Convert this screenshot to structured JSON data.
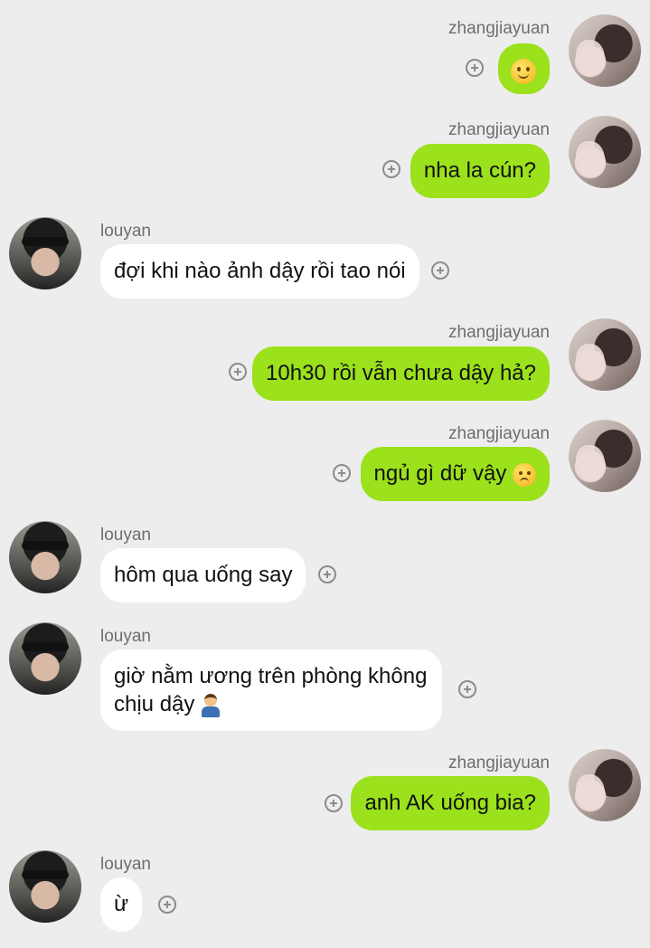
{
  "messages": [
    {
      "sender": "zhangjiayuan",
      "side": "right",
      "text": "",
      "emoji": "slightly-smiling-face"
    },
    {
      "sender": "zhangjiayuan",
      "side": "right",
      "text": "nha la cún?"
    },
    {
      "sender": "louyan",
      "side": "left",
      "text": "đợi khi nào ảnh dậy rồi tao nói"
    },
    {
      "sender": "zhangjiayuan",
      "side": "right",
      "text": "10h30 rồi vẫn chưa dậy hả?"
    },
    {
      "sender": "zhangjiayuan",
      "side": "right",
      "text": "ngủ gì dữ vậy",
      "emoji": "sad-face"
    },
    {
      "sender": "louyan",
      "side": "left",
      "text": "hôm qua uống say"
    },
    {
      "sender": "louyan",
      "side": "left",
      "text": "giờ nằm ương trên phòng không chịu dậy",
      "emoji": "facepalm"
    },
    {
      "sender": "zhangjiayuan",
      "side": "right",
      "text": "anh AK uống bia?"
    },
    {
      "sender": "louyan",
      "side": "left",
      "text": "ừ"
    }
  ],
  "colors": {
    "background": "#ededed",
    "outgoing_bubble": "#9be11c",
    "incoming_bubble": "#ffffff",
    "sender_name": "#6e6e6e",
    "add_reaction_icon": "#8c8c8c"
  }
}
